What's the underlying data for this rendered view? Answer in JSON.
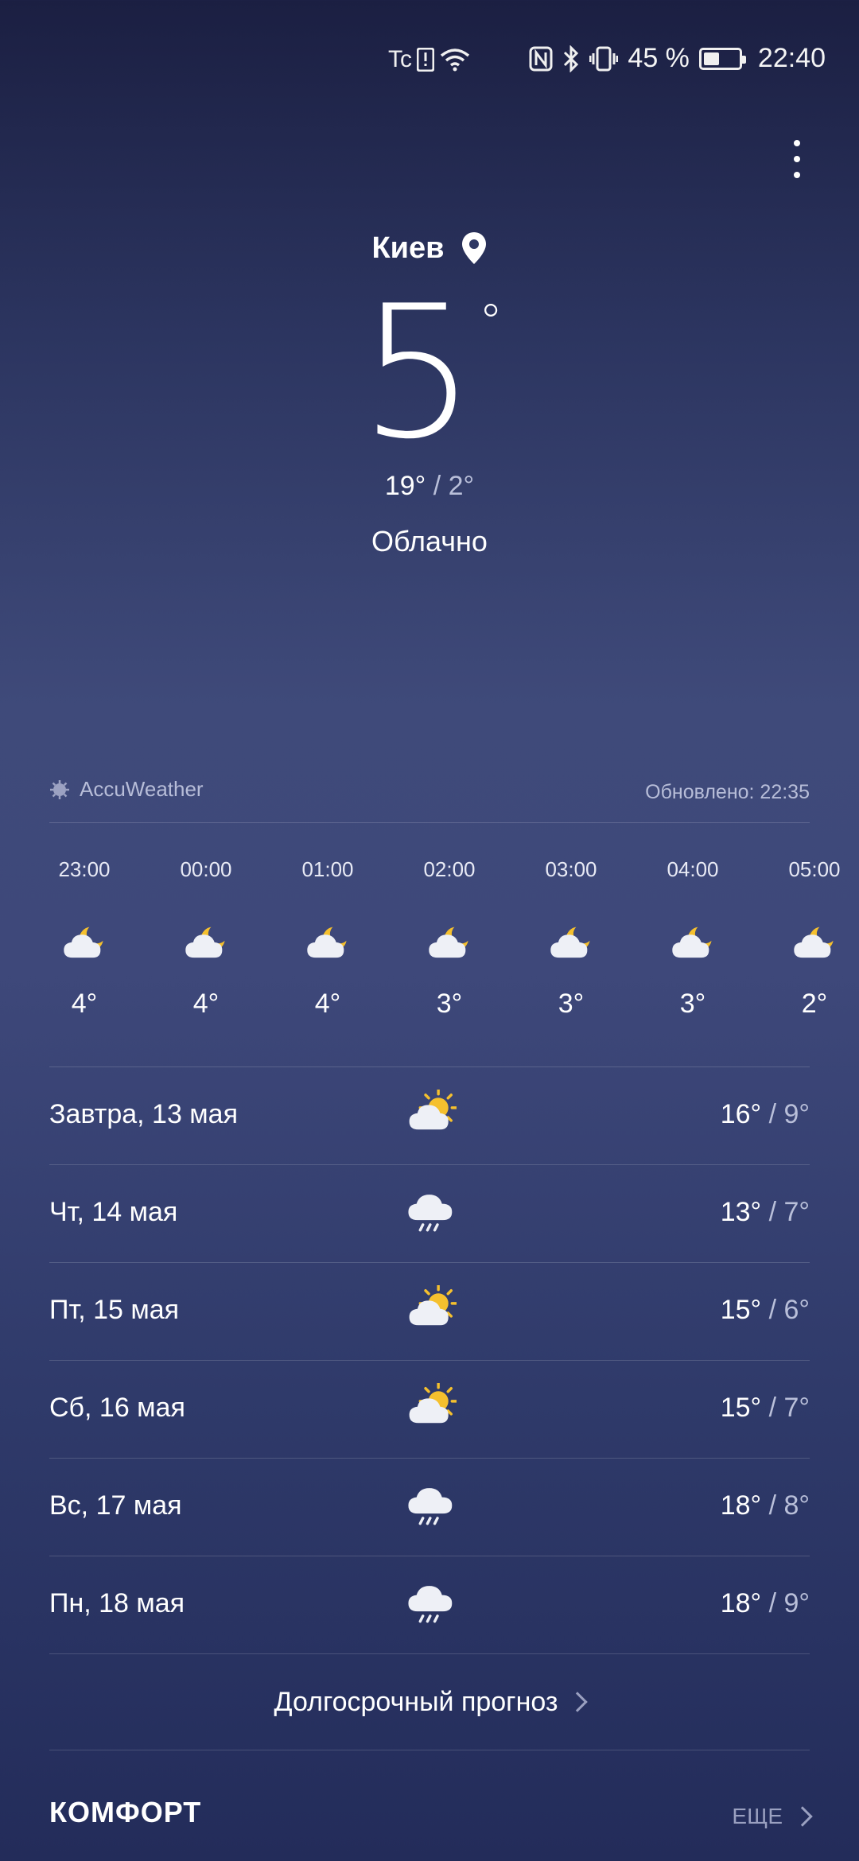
{
  "status_bar": {
    "carrier_icon_text": "Tc",
    "battery_percent": "45 %",
    "battery_level": 0.45,
    "time": "22:40"
  },
  "current": {
    "city": "Киев",
    "temperature": "5",
    "degree_symbol": "°",
    "high": "19°",
    "separator": " / ",
    "low": "2°",
    "condition": "Облачно"
  },
  "source": {
    "provider": "AccuWeather",
    "updated": "Обновлено: 22:35"
  },
  "hourly": [
    {
      "time": "23:00",
      "icon": "moon-cloud-icon",
      "temp": "4°"
    },
    {
      "time": "00:00",
      "icon": "moon-cloud-icon",
      "temp": "4°"
    },
    {
      "time": "01:00",
      "icon": "moon-cloud-icon",
      "temp": "4°"
    },
    {
      "time": "02:00",
      "icon": "moon-cloud-icon",
      "temp": "3°"
    },
    {
      "time": "03:00",
      "icon": "moon-cloud-icon",
      "temp": "3°"
    },
    {
      "time": "04:00",
      "icon": "moon-cloud-icon",
      "temp": "3°"
    },
    {
      "time": "05:00",
      "icon": "moon-cloud-icon",
      "temp": "2°"
    }
  ],
  "daily": [
    {
      "label": "Завтра, 13 мая",
      "icon": "sun-cloud-icon",
      "high": "16°",
      "low": "9°"
    },
    {
      "label": "Чт, 14 мая",
      "icon": "rain-cloud-icon",
      "high": "13°",
      "low": "7°"
    },
    {
      "label": "Пт, 15 мая",
      "icon": "sun-cloud-icon",
      "high": "15°",
      "low": "6°"
    },
    {
      "label": "Сб, 16 мая",
      "icon": "sun-cloud-icon",
      "high": "15°",
      "low": "7°"
    },
    {
      "label": "Вс, 17 мая",
      "icon": "rain-cloud-icon",
      "high": "18°",
      "low": "8°"
    },
    {
      "label": "Пн, 18 мая",
      "icon": "rain-cloud-icon",
      "high": "18°",
      "low": "9°"
    }
  ],
  "long_forecast_label": "Долгосрочный прогноз",
  "comfort": {
    "title": "КОМФОРТ",
    "more_label": "ЕЩЕ"
  },
  "colors": {
    "sun": "#f5c02e",
    "cloud": "#eef0f6",
    "low_temp": "#b9bfd9"
  }
}
